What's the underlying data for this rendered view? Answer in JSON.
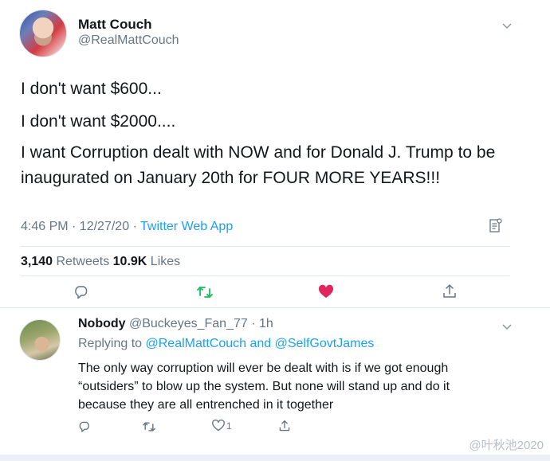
{
  "tweet": {
    "author_name": "Matt Couch",
    "author_handle": "@RealMattCouch",
    "lines": [
      "I don't want $600...",
      "I don't want $2000....",
      "I want Corruption dealt with NOW and for Donald J. Trump to be",
      "inaugurated on January 20th for FOUR MORE YEARS!!!"
    ],
    "time": "4:46 PM · 12/27/20 · ",
    "source": "Twitter Web App",
    "retweets_count": "3,140",
    "retweets_label": " Retweets ",
    "likes_count": "10.9K",
    "likes_label": " Likes"
  },
  "reply": {
    "name": "Nobody",
    "handle_time": " @Buckeyes_Fan_77 · 1h",
    "replying_prefix": "Replying to ",
    "replying_1": "@RealMattCouch",
    "replying_and": " and ",
    "replying_2": "@SelfGovtJames",
    "body_lines": [
      "The only way corruption will ever be dealt with is if we got enough",
      "“outsiders” to blow up the system. But none will stand up and do it",
      "because they are all entrenched in it together"
    ],
    "like_count": "1"
  },
  "watermark": "@叶秋池2020",
  "icons": {
    "reply": "reply-icon",
    "retweet": "retweet-icon",
    "like": "heart-icon",
    "share": "share-icon",
    "caret": "chevron-down-icon",
    "analytics": "analytics-icon"
  },
  "colors": {
    "accent": "#1da1f2",
    "retweet": "#17bf63",
    "like": "#e0245e",
    "muted": "#657786"
  }
}
